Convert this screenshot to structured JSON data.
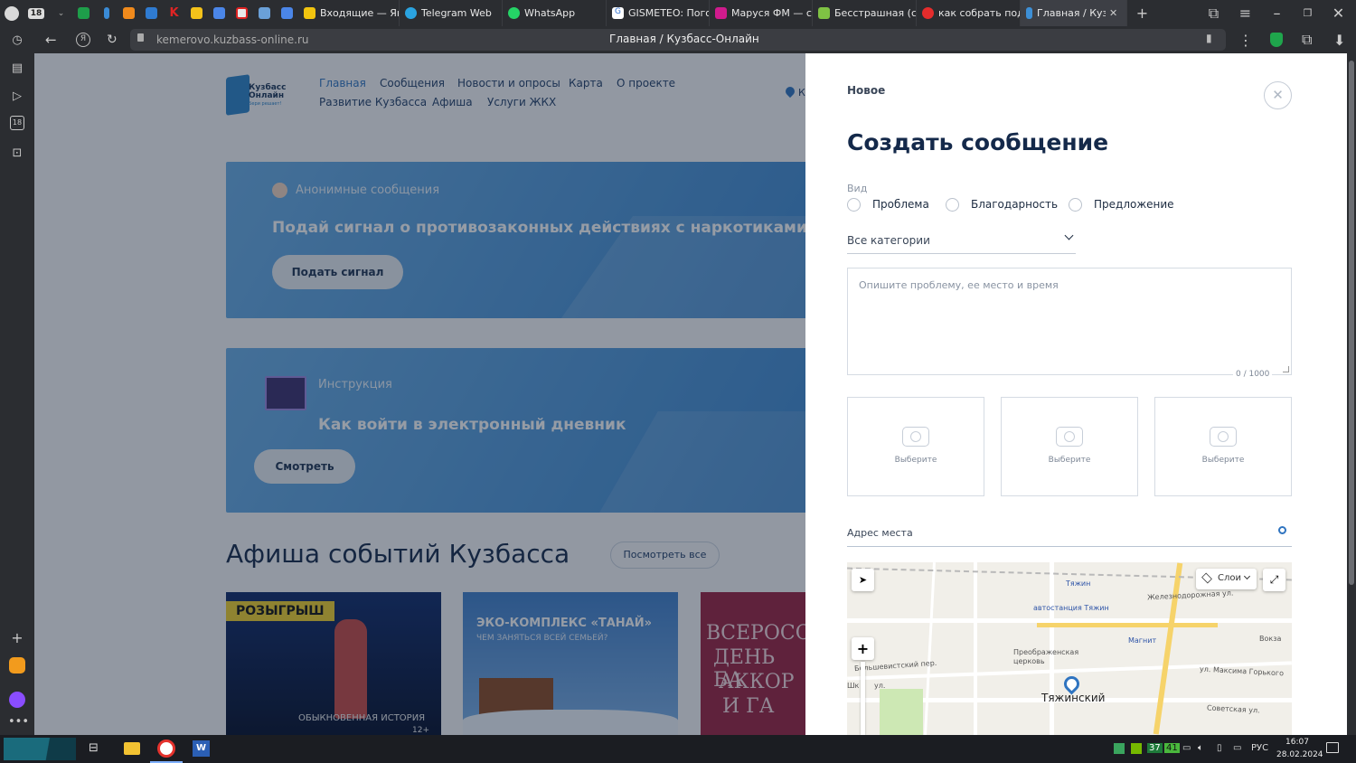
{
  "browser": {
    "tab_count_badge": "18",
    "tabs": [
      {
        "title": "Входящие — Янд",
        "favicon": "mail-icon"
      },
      {
        "title": "Telegram Web",
        "favicon": "telegram-icon"
      },
      {
        "title": "WhatsApp",
        "favicon": "whatsapp-icon"
      },
      {
        "title": "GISMETEO: Погод",
        "favicon": "gismeteo-icon"
      },
      {
        "title": "Маруся ФМ — с",
        "favicon": "play-icon"
      },
      {
        "title": "Бесстрашная (се",
        "favicon": "kino-icon"
      },
      {
        "title": "как собрать подс",
        "favicon": "yandex-icon"
      },
      {
        "title": "Главная / Кузб",
        "favicon": "kuzbass-icon"
      }
    ],
    "url": "kemerovo.kuzbass-online.ru",
    "page_title": "Главная / Кузбасс-Онлайн",
    "sidebar_badge": "18"
  },
  "site": {
    "logo_line1": "Кузбасс",
    "logo_line2": "Онлайн",
    "logo_tagline": "Бери решает!",
    "nav_row1": [
      "Главная",
      "Сообщения",
      "Новости и опросы",
      "Карта",
      "О проекте"
    ],
    "nav_row2": [
      "Развитие Кузбасса",
      "Афиша",
      "Услуги ЖКХ"
    ],
    "location_short": "К",
    "banner1": {
      "tag": "Анонимные сообщения",
      "headline": "Подай сигнал о противозаконных действиях с наркотиками",
      "button": "Подать сигнал"
    },
    "banner2": {
      "tag": "Инструкция",
      "headline": "Как войти в электронный дневник",
      "button": "Смотреть"
    },
    "events_title": "Афиша событий Кузбасса",
    "events_all": "Посмотреть все",
    "cards": [
      {
        "badge": "РОЗЫГРЫШ",
        "caption": "ОБЫКНОВЕННАЯ ИСТОРИЯ",
        "age": "12+"
      },
      {
        "title": "ЭКО-КОМПЛЕКС «ТАНАЙ»",
        "subtitle": "ЧЕМ ЗАНЯТЬСЯ ВСЕЙ СЕМЬЕЙ?"
      },
      {
        "lines": [
          "ВСЕРОСС",
          "ДЕНЬ БА",
          "АККОР",
          "И ГА"
        ]
      }
    ]
  },
  "panel": {
    "breadcrumb": "Новое",
    "title": "Создать сообщение",
    "type_label": "Вид",
    "types": [
      "Проблема",
      "Благодарность",
      "Предложение"
    ],
    "category": "Все категории",
    "textarea_placeholder": "Опишите проблему, ее место и время",
    "counter": "0 / 1000",
    "upload_label": "Выберите",
    "address_placeholder": "Адрес места",
    "map": {
      "layers_label": "Слои",
      "labels": [
        "Тяжин",
        "автостанция Тяжин",
        "Железнодорожная ул.",
        "Магнит",
        "Вокза",
        "Преображенская церковь",
        "Большевистский пер.",
        "ул. Максима Горького",
        "Тяжинский",
        "Советская ул.",
        "Шк",
        "ул."
      ]
    }
  },
  "taskbar": {
    "tray_num1": "37",
    "tray_num2": "41",
    "lang": "РУС",
    "time": "16:07",
    "date": "28.02.2024"
  },
  "colors": {
    "accent": "#2f74c0",
    "brand_dark": "#14294a",
    "banner": "#3b86cf"
  }
}
